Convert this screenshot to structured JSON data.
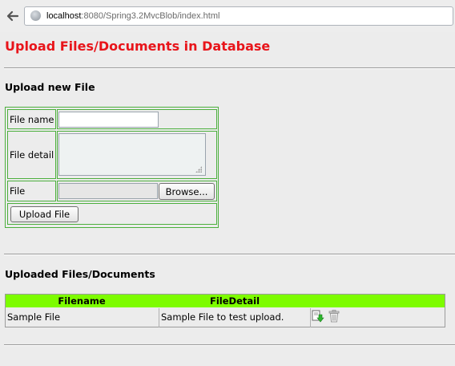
{
  "browser": {
    "url_host": "localhost",
    "url_path": ":8080/Spring3.2MvcBlob/index.html"
  },
  "page": {
    "title": "Upload Files/Documents in Database"
  },
  "upload_section": {
    "heading": "Upload new File",
    "file_name_label": "File name",
    "file_name_value": "",
    "file_detail_label": "File detail",
    "file_detail_value": "",
    "file_label": "File",
    "browse_label": "Browse...",
    "submit_label": "Upload File"
  },
  "files_section": {
    "heading": "Uploaded Files/Documents",
    "columns": [
      "Filename",
      "FileDetail"
    ],
    "rows": [
      {
        "filename": "Sample File",
        "detail": "Sample File to test upload."
      }
    ],
    "row_icons": [
      "download-icon",
      "trash-icon"
    ]
  },
  "colors": {
    "title": "#e8141a",
    "header_bg": "#7dfc00",
    "form_border": "#4caf3d"
  }
}
